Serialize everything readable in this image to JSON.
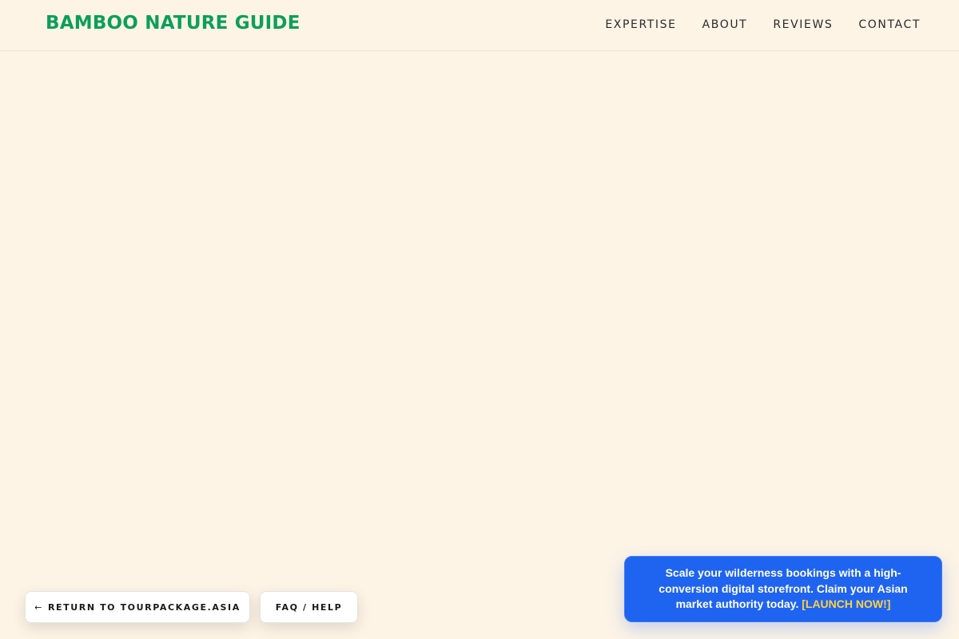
{
  "header": {
    "brand": "BAMBOO NATURE GUIDE",
    "nav": {
      "expertise": "EXPERTISE",
      "about": "ABOUT",
      "reviews": "REVIEWS",
      "contact": "CONTACT"
    }
  },
  "footer_buttons": {
    "return_arrow": "←",
    "return_label": "RETURN TO TOURPACKAGE.ASIA",
    "faq_label": "FAQ / HELP"
  },
  "promo": {
    "message": "Scale your wilderness bookings with a high-conversion digital storefront. Claim your Asian market authority today.",
    "cta": "[LAUNCH NOW!]"
  },
  "colors": {
    "background": "#fdf4e6",
    "brand": "#0b9f5a",
    "promo_background": "#1f64f0",
    "promo_cta": "#ffd23f"
  }
}
